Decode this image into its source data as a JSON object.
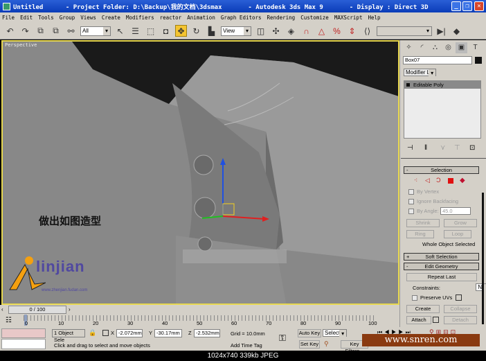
{
  "title": {
    "text": "Untitled      - Project Folder: D:\\Backup\\我的文档\\3dsmax       - Autodesk 3ds Max 9       - Display : Direct 3D"
  },
  "menu": [
    "File",
    "Edit",
    "Tools",
    "Group",
    "Views",
    "Create",
    "Modifiers",
    "reactor",
    "Animation",
    "Graph Editors",
    "Rendering",
    "Customize",
    "MAXScript",
    "Help"
  ],
  "toolbar": {
    "selection_filter": "All",
    "ref_coord": "View"
  },
  "viewport": {
    "label": "Perspective",
    "annotation": "做出如图造型",
    "logo": "linjian",
    "logo_url": "www.zhenjian.fudan.com"
  },
  "command_panel": {
    "object_name": "Box07",
    "modifier_list": "Modifier List",
    "stack_item": "Editable Poly",
    "selection": {
      "title": "Selection",
      "by_vertex": "By Vertex",
      "ignore_backfacing": "Ignore Backfacing",
      "by_angle": "By Angle:",
      "angle_value": "45.0",
      "shrink": "Shrink",
      "grow": "Grow",
      "ring": "Ring",
      "loop": "Loop",
      "status": "Whole Object Selected"
    },
    "soft_selection": "Soft Selection",
    "edit_geometry": {
      "title": "Edit Geometry",
      "repeat_last": "Repeat Last",
      "constraints_label": "Constraints:",
      "constraints_value": "None",
      "preserve_uvs": "Preserve UVs",
      "create": "Create",
      "collapse": "Collapse",
      "attach": "Attach",
      "detach": "Detach"
    }
  },
  "timeline": {
    "frame": "0 / 100",
    "ticks": [
      "0",
      "10",
      "20",
      "30",
      "40",
      "50",
      "60",
      "70",
      "80",
      "90",
      "100"
    ]
  },
  "status": {
    "selected": "1 Object Sele",
    "x": "-2.072mm",
    "y": "-30.17mm",
    "z": "-2.532mm",
    "grid": "Grid = 10.0mm",
    "prompt": "Click and drag to select and move objects",
    "add_time_tag": "Add Time Tag",
    "auto_key": "Auto Key",
    "set_key": "Set Key",
    "key_mode": "Selected",
    "key_filters": "Key Filters..."
  },
  "watermark": "www.snren.com",
  "caption": "1024x740  339kb  JPEG"
}
